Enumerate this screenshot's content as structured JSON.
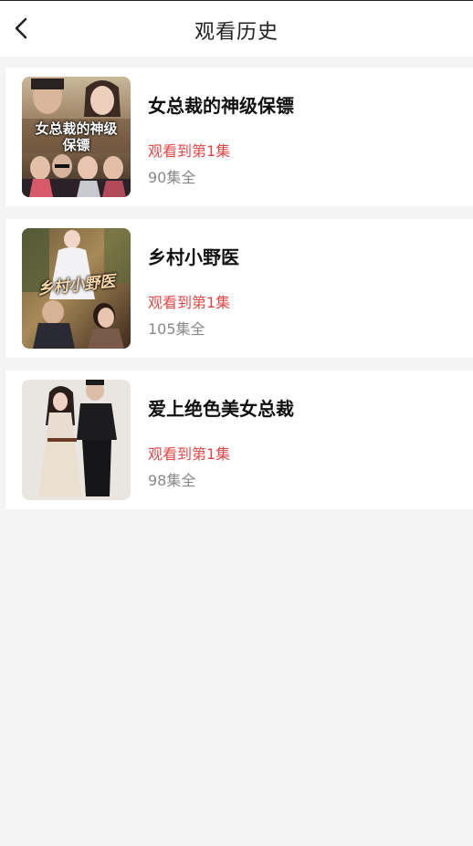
{
  "header": {
    "title": "观看历史"
  },
  "history": [
    {
      "title": "女总裁的神级保镖",
      "progress": "观看到第1集",
      "episodes": "90集全",
      "poster_text": "女总裁的神级保镖"
    },
    {
      "title": "乡村小野医",
      "progress": "观看到第1集",
      "episodes": "105集全",
      "poster_text": "乡村小野医"
    },
    {
      "title": "爱上绝色美女总裁",
      "progress": "观看到第1集",
      "episodes": "98集全"
    }
  ],
  "colors": {
    "accent": "#e04848",
    "background": "#f4f4f4",
    "card": "#ffffff"
  },
  "icons": {
    "back": "chevron-left-icon"
  }
}
